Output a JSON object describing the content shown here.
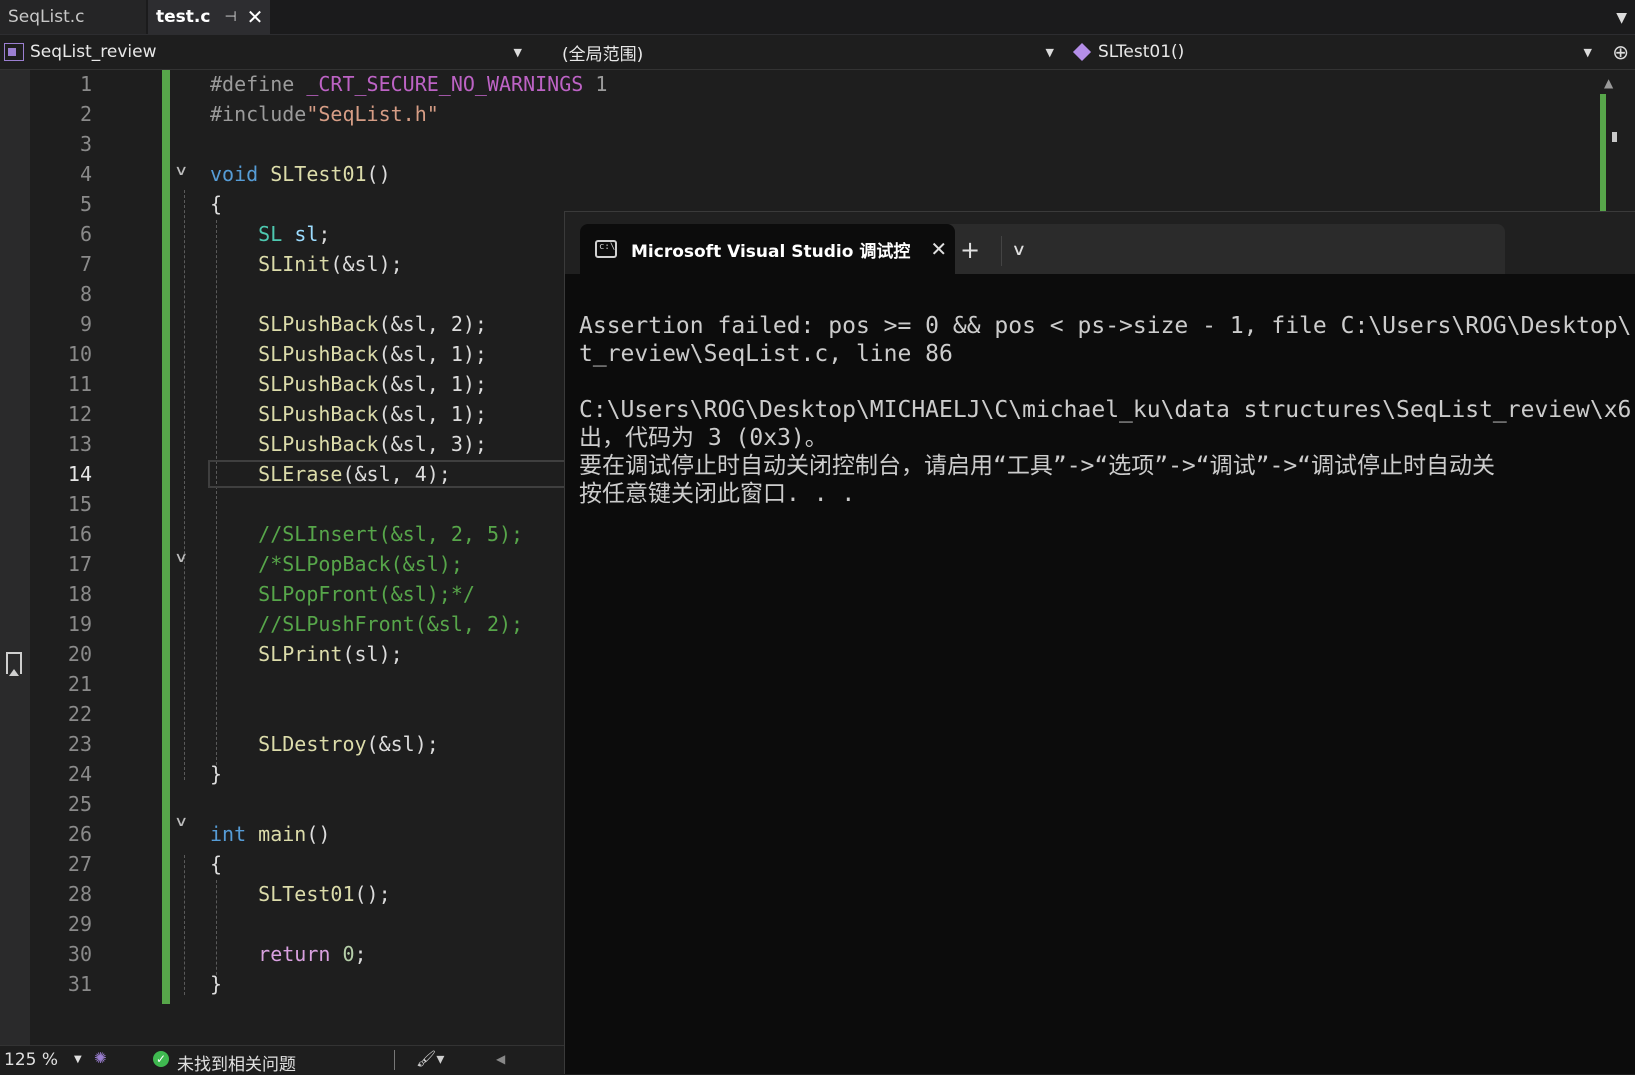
{
  "tabs": [
    {
      "label": "SeqList.c",
      "active": false
    },
    {
      "label": "test.c",
      "active": true,
      "pin": "⊣",
      "close": "✕"
    }
  ],
  "navbar": {
    "project": "SeqList_review",
    "scope": "(全局范围)",
    "function": "SLTest01()"
  },
  "line_numbers": [
    "1",
    "2",
    "3",
    "4",
    "5",
    "6",
    "7",
    "8",
    "9",
    "10",
    "11",
    "12",
    "13",
    "14",
    "15",
    "16",
    "17",
    "18",
    "19",
    "20",
    "21",
    "22",
    "23",
    "24",
    "25",
    "26",
    "27",
    "28",
    "29",
    "30",
    "31"
  ],
  "code": {
    "l1_directive": "#define",
    "l1_macro": "_CRT_SECURE_NO_WARNINGS",
    "l1_value": "1",
    "l2_directive": "#include",
    "l2_header": "\"SeqList.h\"",
    "l4_type": "void",
    "l4_name": "SLTest01",
    "l4_paren": "()",
    "open_brace": "{",
    "close_brace": "}",
    "l6_type": "SL",
    "l6_var": "sl",
    "l6_end": ";",
    "l7_fn": "SLInit",
    "l7_args": "(&sl);",
    "push_fn": "SLPushBack",
    "l9_args": "(&sl, 2);",
    "l10_args": "(&sl, 1);",
    "l11_args": "(&sl, 1);",
    "l12_args": "(&sl, 1);",
    "l13_args": "(&sl, 3);",
    "l14_fn": "SLErase",
    "l14_args": "(&sl, 4);",
    "l16_comment": "//SLInsert(&sl, 2, 5);",
    "l17_comment": "/*SLPopBack(&sl);",
    "l18_comment": "SLPopFront(&sl);*/",
    "l19_comment": "//SLPushFront(&sl, 2);",
    "l20_fn": "SLPrint",
    "l20_args": "(sl);",
    "l23_fn": "SLDestroy",
    "l23_args": "(&sl);",
    "l26_type": "int",
    "l26_name": "main",
    "l26_paren": "()",
    "l28_call": "SLTest01",
    "l28_end": "();",
    "l30_kw": "return",
    "l30_val": "0",
    "l30_end": ";"
  },
  "statusbar": {
    "zoom": "125 %",
    "issues": "未找到相关问题"
  },
  "console": {
    "title": "Microsoft Visual Studio 调试控",
    "lines": [
      "Assertion failed: pos >= 0 && pos < ps->size - 1, file C:\\Users\\ROG\\Desktop\\",
      "t_review\\SeqList.c, line 86",
      "",
      "C:\\Users\\ROG\\Desktop\\MICHAELJ\\C\\michael_ku\\data structures\\SeqList_review\\x6",
      "出，代码为 3 (0x3)。",
      "要在调试停止时自动关闭控制台，请启用“工具”->“选项”->“调试”->“调试停止时自动关",
      "按任意键关闭此窗口. . ."
    ]
  }
}
